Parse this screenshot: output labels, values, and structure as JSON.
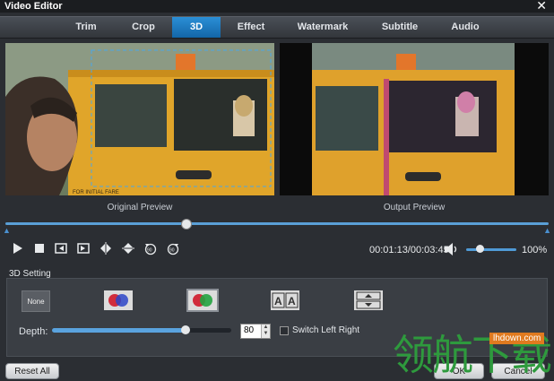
{
  "window": {
    "title": "Video Editor",
    "close_glyph": "✕"
  },
  "tabs": [
    {
      "label": "Trim",
      "active": false
    },
    {
      "label": "Crop",
      "active": false
    },
    {
      "label": "3D",
      "active": true
    },
    {
      "label": "Effect",
      "active": false
    },
    {
      "label": "Watermark",
      "active": false
    },
    {
      "label": "Subtitle",
      "active": false
    },
    {
      "label": "Audio",
      "active": false
    }
  ],
  "preview": {
    "original_label": "Original Preview",
    "output_label": "Output Preview",
    "taxi_sign": "FOR INITIAL FARE"
  },
  "playback": {
    "time_current": "00:01:13",
    "time_total": "00:03:45",
    "timecode": "00:01:13/00:03:45",
    "position_fraction": 0.33,
    "volume_percent": "100%",
    "volume_fraction": 0.25
  },
  "settings_3d": {
    "section_title": "3D Setting",
    "modes": [
      {
        "label": "None",
        "icon": "none-mode-icon"
      },
      {
        "label": "",
        "icon": "anaglyph-red-blue-icon"
      },
      {
        "label": "",
        "icon": "anaglyph-red-green-icon",
        "selected": true
      },
      {
        "label": "",
        "icon": "side-by-side-icon"
      },
      {
        "label": "",
        "icon": "top-bottom-icon"
      }
    ],
    "depth_label": "Depth:",
    "depth_value": "80",
    "depth_fraction": 0.74,
    "switch_label": "Switch Left Right",
    "switch_checked": false
  },
  "footer": {
    "reset_label": "Reset All",
    "ok_label": "OK",
    "cancel_label": "Cancel"
  },
  "watermark": {
    "url": "lhdown.com",
    "text": "领航下载"
  },
  "colors": {
    "accent": "#1a78c2",
    "taxi": "#e0a52a"
  }
}
